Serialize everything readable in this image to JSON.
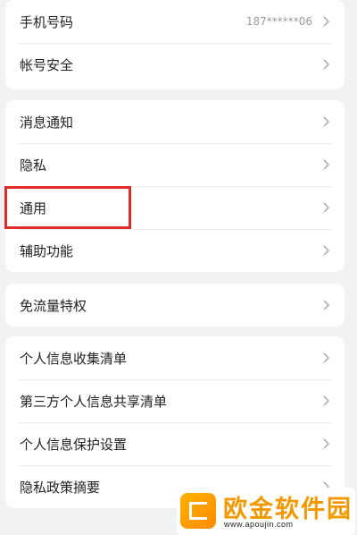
{
  "group1": {
    "items": [
      {
        "label": "手机号码",
        "value": "187******06"
      },
      {
        "label": "帐号安全"
      }
    ]
  },
  "group2": {
    "items": [
      {
        "label": "消息通知"
      },
      {
        "label": "隐私"
      },
      {
        "label": "通用"
      },
      {
        "label": "辅助功能"
      }
    ]
  },
  "group3": {
    "items": [
      {
        "label": "免流量特权"
      }
    ]
  },
  "group4": {
    "items": [
      {
        "label": "个人信息收集清单"
      },
      {
        "label": "第三方个人信息共享清单"
      },
      {
        "label": "个人信息保护设置"
      },
      {
        "label": "隐私政策摘要"
      }
    ]
  },
  "icons": {
    "chevron": "chevron-right-icon"
  },
  "colors": {
    "highlight": "#e22a2a",
    "background": "#f1f2f4",
    "card": "#ffffff",
    "watermark": "#f39800"
  },
  "watermark": {
    "text": "欧金软件园",
    "url": "www.apoujin.com"
  }
}
